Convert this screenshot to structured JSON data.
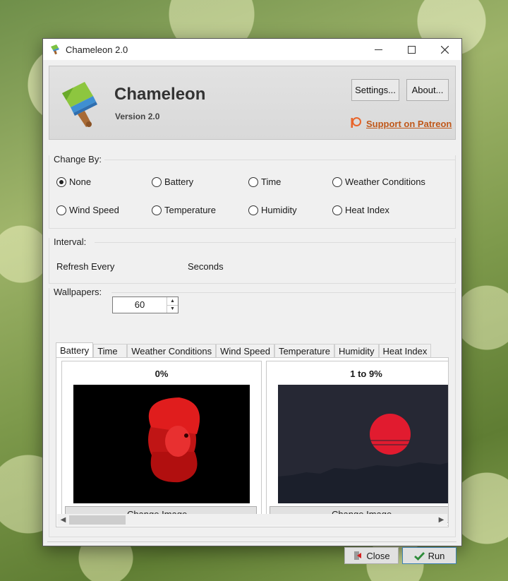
{
  "window": {
    "title": "Chameleon 2.0",
    "controls": {
      "minimize_icon": "minimize-icon",
      "maximize_icon": "maximize-icon",
      "close_icon": "close-icon"
    }
  },
  "header": {
    "app_name": "Chameleon",
    "version": "Version 2.0",
    "settings_label": "Settings...",
    "about_label": "About...",
    "patreon_label": "Support on Patreon",
    "patreon_color": "#c0581a"
  },
  "change_by": {
    "label": "Change By:",
    "options": [
      "None",
      "Battery",
      "Time",
      "Weather Conditions",
      "Wind Speed",
      "Temperature",
      "Humidity",
      "Heat Index"
    ],
    "selected": "None"
  },
  "interval": {
    "label": "Interval:",
    "refresh_label": "Refresh Every",
    "value": "60",
    "unit": "Seconds"
  },
  "wallpapers": {
    "label": "Wallpapers:",
    "tabs": [
      "Battery",
      "Time",
      "Weather Conditions",
      "Wind Speed",
      "Temperature",
      "Humidity",
      "Heat Index"
    ],
    "active_tab": "Battery",
    "cards": [
      {
        "title": "0%",
        "button": "Change Image..."
      },
      {
        "title": "1 to 9%",
        "button": "Change Image..."
      }
    ]
  },
  "footer": {
    "close_label": "Close",
    "run_label": "Run",
    "accent": "#2e8b3a"
  }
}
